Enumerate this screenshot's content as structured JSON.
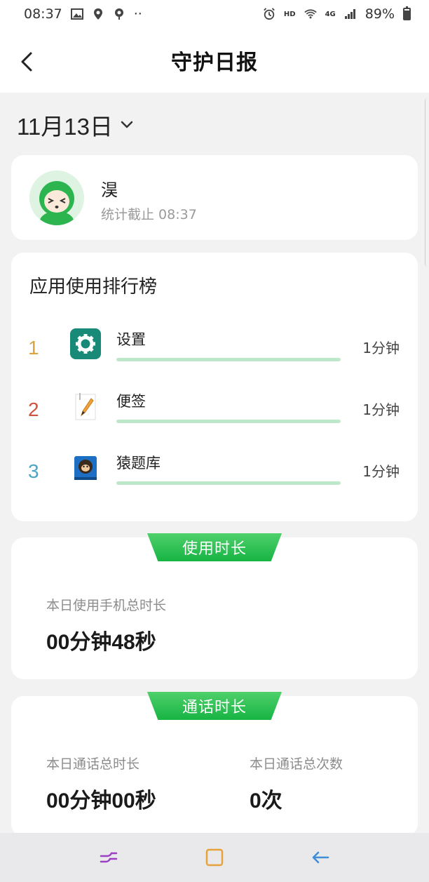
{
  "status_bar": {
    "time": "08:37",
    "dots": "··",
    "hd": "HD",
    "net": "4G",
    "battery": "89%"
  },
  "header": {
    "title": "守护日报"
  },
  "date_selector": {
    "label": "11月13日"
  },
  "profile": {
    "name": "淏",
    "subtitle": "统计截止 08:37"
  },
  "ranking": {
    "title": "应用使用排行榜",
    "items": [
      {
        "rank": "1",
        "name": "设置",
        "time": "1分钟",
        "rank_color": "#d9a441",
        "icon": "gear-icon",
        "usage_fraction": 1.0
      },
      {
        "rank": "2",
        "name": "便签",
        "time": "1分钟",
        "rank_color": "#d0533f",
        "icon": "notepad-icon",
        "usage_fraction": 1.0
      },
      {
        "rank": "3",
        "name": "猿题库",
        "time": "1分钟",
        "rank_color": "#4ba6c4",
        "icon": "book-monkey-icon",
        "usage_fraction": 1.0
      }
    ]
  },
  "usage": {
    "tab": "使用时长",
    "label": "本日使用手机总时长",
    "value": "00分钟48秒"
  },
  "calls": {
    "tab": "通话时长",
    "duration_label": "本日通话总时长",
    "duration_value": "00分钟00秒",
    "count_label": "本日通话总次数",
    "count_value": "0次"
  },
  "colors": {
    "accent_green": "#1fb84a",
    "bar_green": "#bfe8cb"
  }
}
